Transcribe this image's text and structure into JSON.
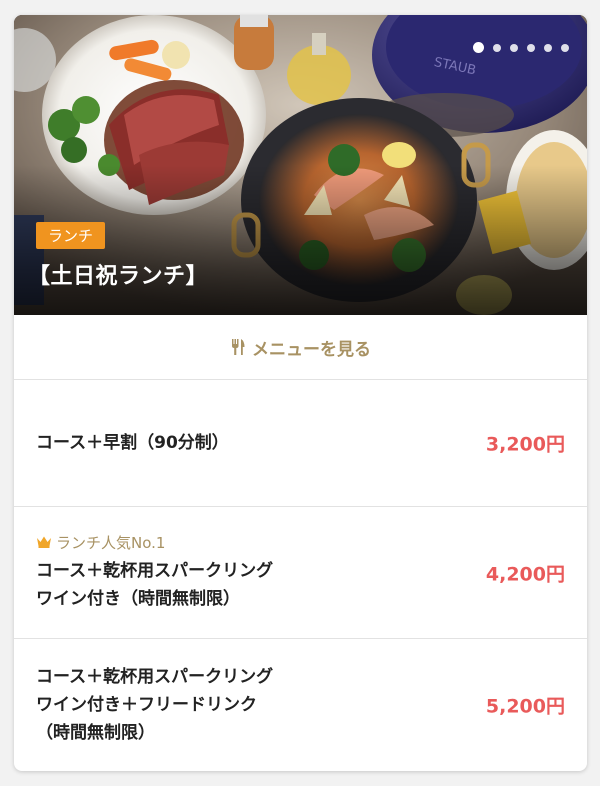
{
  "hero": {
    "badge": "ランチ",
    "title": "【土日祝ランチ】",
    "slide_count": 6,
    "active_slide": 1,
    "plate_text": "STAUB"
  },
  "menu_link": {
    "label": "メニューを見る",
    "icon": "fork-knife-icon"
  },
  "courses": [
    {
      "name_lines": [
        "コース＋早割（90分制）"
      ],
      "price": "3,200円"
    },
    {
      "tag": "ランチ人気No.1",
      "tag_icon": "crown-icon",
      "name_lines": [
        "コース＋乾杯用スパークリング",
        "ワイン付き（時間無制限）"
      ],
      "price": "4,200円"
    },
    {
      "name_lines": [
        "コース＋乾杯用スパークリング",
        "ワイン付き＋フリードリンク",
        "（時間無制限）"
      ],
      "price": "5,200円"
    }
  ],
  "colors": {
    "accent_gold": "#a89263",
    "price_red": "#e95a5a",
    "badge_orange": "#f0941f"
  }
}
